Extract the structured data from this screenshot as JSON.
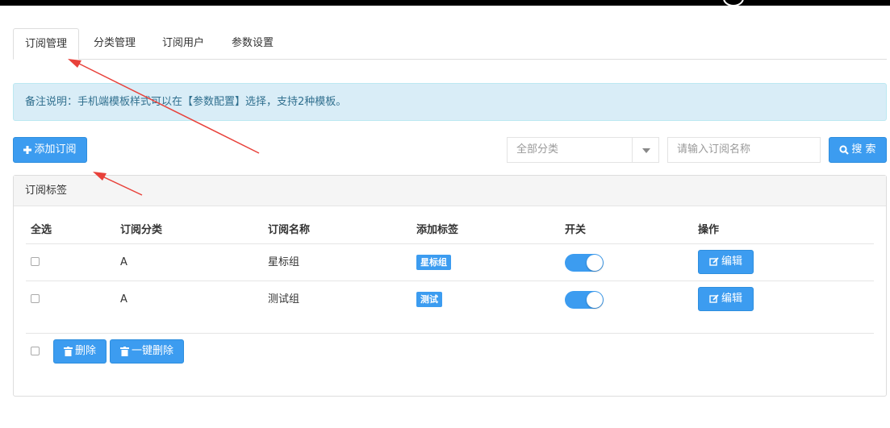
{
  "tabs": [
    {
      "label": "订阅管理",
      "active": true
    },
    {
      "label": "分类管理"
    },
    {
      "label": "订阅用户"
    },
    {
      "label": "参数设置"
    }
  ],
  "notice": "备注说明：手机端模板样式可以在【参数配置】选择，支持2种模板。",
  "toolbar": {
    "add_label": "添加订阅",
    "category_select_value": "全部分类",
    "search_placeholder": "请输入订阅名称",
    "search_label": "搜 索"
  },
  "panel": {
    "title": "订阅标签",
    "columns": [
      "全选",
      "订阅分类",
      "订阅名称",
      "添加标签",
      "开关",
      "操作"
    ],
    "rows": [
      {
        "category": "A",
        "name": "星标组",
        "tag": "星标组",
        "enabled": true,
        "action": "编辑"
      },
      {
        "category": "A",
        "name": "测试组",
        "tag": "测试",
        "enabled": true,
        "action": "编辑"
      }
    ],
    "footer": {
      "delete_label": "删除",
      "delete_all_label": "一键删除"
    }
  },
  "colors": {
    "accent": "#3c9cf0",
    "notice_bg": "#d9edf7",
    "notice_text": "#31708f",
    "annotation": "#e8413a"
  }
}
